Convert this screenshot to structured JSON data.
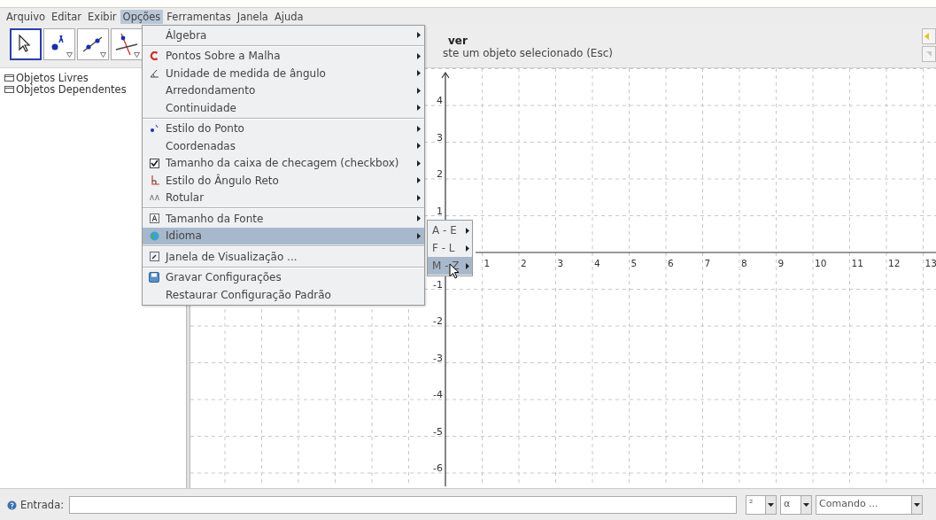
{
  "menubar": [
    {
      "label": "Arquivo",
      "selected": false
    },
    {
      "label": "Editar",
      "selected": false
    },
    {
      "label": "Exibir",
      "selected": false
    },
    {
      "label": "Opções",
      "selected": true
    },
    {
      "label": "Ferramentas",
      "selected": false
    },
    {
      "label": "Janela",
      "selected": false
    },
    {
      "label": "Ajuda",
      "selected": false
    }
  ],
  "toolbar": {
    "tools": [
      {
        "kind": "move",
        "selected": true
      },
      {
        "kind": "point",
        "selected": false
      },
      {
        "kind": "line",
        "selected": false
      },
      {
        "kind": "perpendicular",
        "selected": false
      }
    ],
    "tool_name": "ver",
    "tool_help": "ste um objeto selecionado (Esc)"
  },
  "algebra": {
    "items": [
      {
        "label": "Objetos Livres"
      },
      {
        "label": "Objetos Dependentes"
      }
    ]
  },
  "graphics": {
    "x_labels": [
      "1",
      "2",
      "3",
      "4",
      "5",
      "6",
      "7",
      "8",
      "9",
      "10",
      "11",
      "12",
      "13"
    ],
    "y_labels": [
      "4",
      "3",
      "2",
      "1",
      "-1",
      "-2",
      "-3",
      "-4",
      "-5",
      "-6"
    ]
  },
  "menu": {
    "groups": [
      [
        {
          "label": "Álgebra",
          "kind": "plain",
          "submenu": true,
          "selected": false
        }
      ],
      [
        {
          "label": "Pontos Sobre a Malha",
          "kind": "magnet",
          "submenu": true,
          "selected": false
        },
        {
          "label": "Unidade de medida de ângulo",
          "kind": "angle",
          "submenu": true,
          "selected": false
        },
        {
          "label": "Arredondamento",
          "kind": "plain",
          "submenu": true,
          "selected": false
        },
        {
          "label": "Continuidade",
          "kind": "plain",
          "submenu": true,
          "selected": false
        }
      ],
      [
        {
          "label": "Estilo do Ponto",
          "kind": "point",
          "submenu": true,
          "selected": false
        },
        {
          "label": "Coordenadas",
          "kind": "plain",
          "submenu": true,
          "selected": false
        },
        {
          "label": "Tamanho da caixa de checagem (checkbox)",
          "kind": "check",
          "checked": true,
          "submenu": true,
          "selected": false
        },
        {
          "label": "Estilo do Ângulo Reto",
          "kind": "right-angle",
          "submenu": true,
          "selected": false
        },
        {
          "label": "Rotular",
          "kind": "label",
          "submenu": true,
          "selected": false
        }
      ],
      [
        {
          "label": "Tamanho da Fonte",
          "kind": "font",
          "submenu": true,
          "selected": false
        },
        {
          "label": "Idioma",
          "kind": "globe",
          "submenu": true,
          "selected": true
        }
      ],
      [
        {
          "label": "Janela de Visualização ...",
          "kind": "view",
          "submenu": false,
          "selected": false
        }
      ],
      [
        {
          "label": "Gravar Configurações",
          "kind": "save",
          "submenu": false,
          "selected": false
        },
        {
          "label": "Restaurar Configuração Padrão",
          "kind": "plain",
          "submenu": false,
          "selected": false
        }
      ]
    ]
  },
  "submenu": {
    "items": [
      {
        "label": "A - E",
        "selected": false
      },
      {
        "label": "F - L",
        "selected": false
      },
      {
        "label": "M - Z",
        "selected": true
      }
    ]
  },
  "input_bar": {
    "label": "Entrada:",
    "symbols": "²",
    "greek": "α",
    "command": "Comando ..."
  }
}
